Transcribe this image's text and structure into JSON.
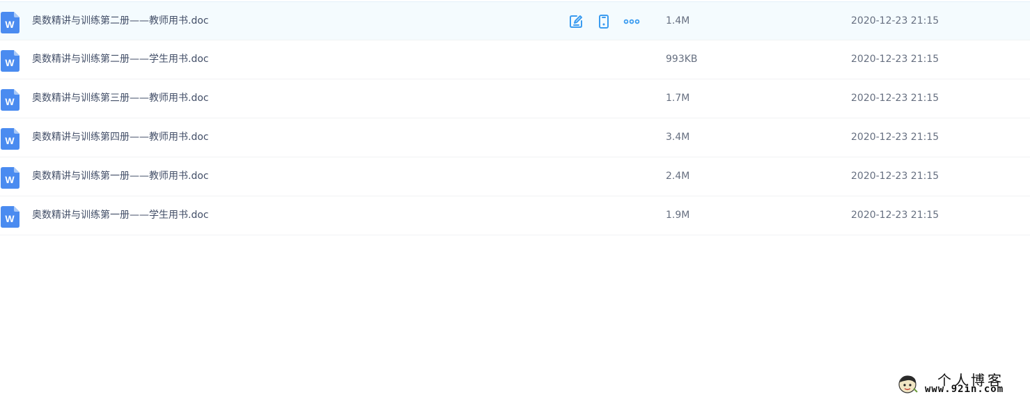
{
  "file_list": {
    "rows": [
      {
        "icon": "word-doc-icon",
        "name": "奥数精讲与训练第二册——教师用书.doc",
        "size": "1.4M",
        "modified": "2020-12-23 21:15",
        "hovered": true
      },
      {
        "icon": "word-doc-icon",
        "name": "奥数精讲与训练第二册——学生用书.doc",
        "size": "993KB",
        "modified": "2020-12-23 21:15",
        "hovered": false
      },
      {
        "icon": "word-doc-icon",
        "name": "奥数精讲与训练第三册——教师用书.doc",
        "size": "1.7M",
        "modified": "2020-12-23 21:15",
        "hovered": false
      },
      {
        "icon": "word-doc-icon",
        "name": "奥数精讲与训练第四册——教师用书.doc",
        "size": "3.4M",
        "modified": "2020-12-23 21:15",
        "hovered": false
      },
      {
        "icon": "word-doc-icon",
        "name": "奥数精讲与训练第一册——教师用书.doc",
        "size": "2.4M",
        "modified": "2020-12-23 21:15",
        "hovered": false
      },
      {
        "icon": "word-doc-icon",
        "name": "奥数精讲与训练第一册——学生用书.doc",
        "size": "1.9M",
        "modified": "2020-12-23 21:15",
        "hovered": false
      }
    ],
    "hover_actions": [
      {
        "icon": "edit-icon"
      },
      {
        "icon": "phone-icon"
      },
      {
        "icon": "more-dots-icon"
      }
    ]
  },
  "watermark": {
    "title": "个人博客",
    "url": "www.92in.com"
  },
  "colors": {
    "accent": "#3b9cf0",
    "doc_icon": "#4a8bf0",
    "text_primary": "#424e67",
    "text_secondary": "#666f80",
    "hover_bg": "#f4fbfe"
  }
}
